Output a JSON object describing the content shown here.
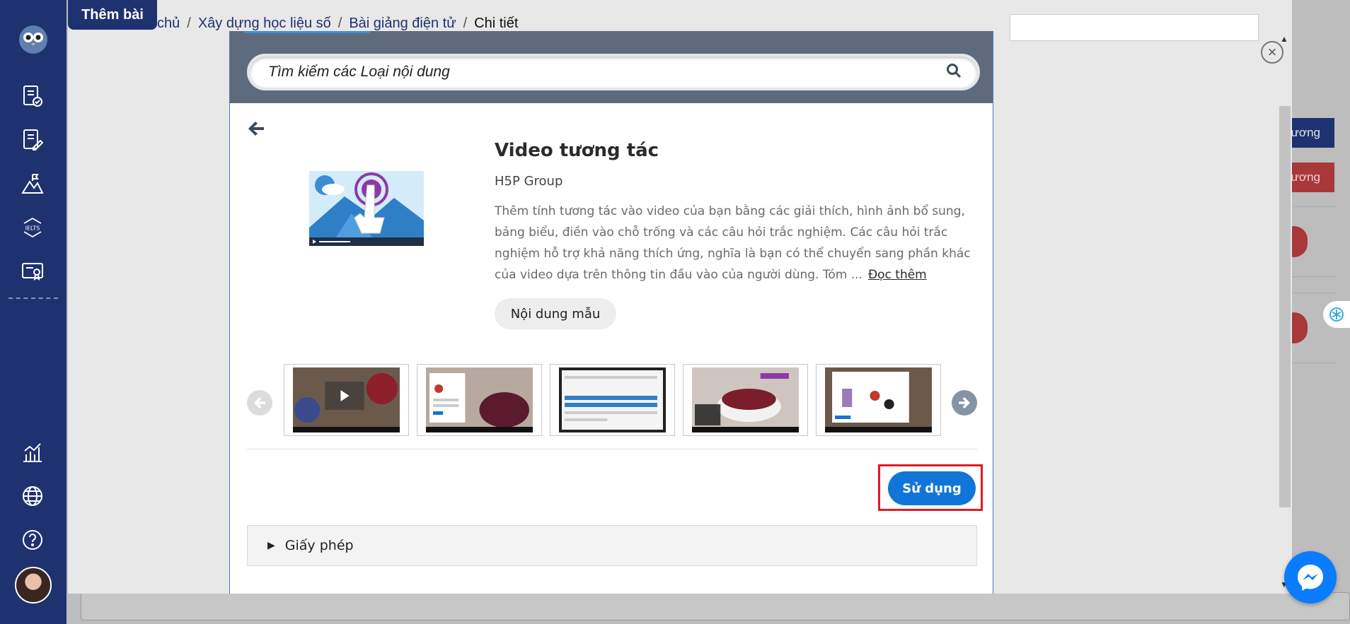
{
  "app": {
    "add_tab_label": "Thêm bài",
    "breadcrumb": [
      "chủ",
      "Xây dựng học liệu số",
      "Bài giảng điện tử",
      "Chi tiết"
    ],
    "breadcrumb_sep": "/"
  },
  "sidebar": {
    "items": [
      "assignment-check-icon",
      "edit-doc-icon",
      "landscape-flag-icon",
      "ielts-icon",
      "certificate-icon",
      "chart-icon",
      "globe-icon",
      "help-icon"
    ],
    "ielts_text": "IELTS"
  },
  "background": {
    "btn_blue": "chương",
    "btn_red": "hương"
  },
  "hub": {
    "search_placeholder": "Tìm kiếm các Loại nội dung",
    "content_type": {
      "title": "Video tương tác",
      "owner": "H5P Group",
      "description": "Thêm tính tương tác vào video của bạn bằng các giải thích, hình ảnh bổ sung, bảng biểu, điền vào chỗ trống và các câu hỏi trắc nghiệm. Các câu hỏi trắc nghiệm hỗ trợ khả năng thích ứng, nghĩa là bạn có thể chuyển sang phần khác của video dựa trên thông tin đầu vào của người dùng. Tóm ...",
      "read_more": "Đọc thêm",
      "demo_label": "Nội dung mẫu",
      "use_label": "Sử dụng",
      "license_label": "Giấy phép"
    },
    "screenshots": [
      "video-smoothie-screenshot",
      "strawberry-quiz-screenshot",
      "editor-form-screenshot",
      "strawberry-bowl-screenshot",
      "summary-overlay-screenshot"
    ]
  },
  "colors": {
    "sidebar": "#1e3270",
    "use_button": "#1175d8",
    "highlight": "#e11b22",
    "hub_header": "#5d6b7d"
  }
}
